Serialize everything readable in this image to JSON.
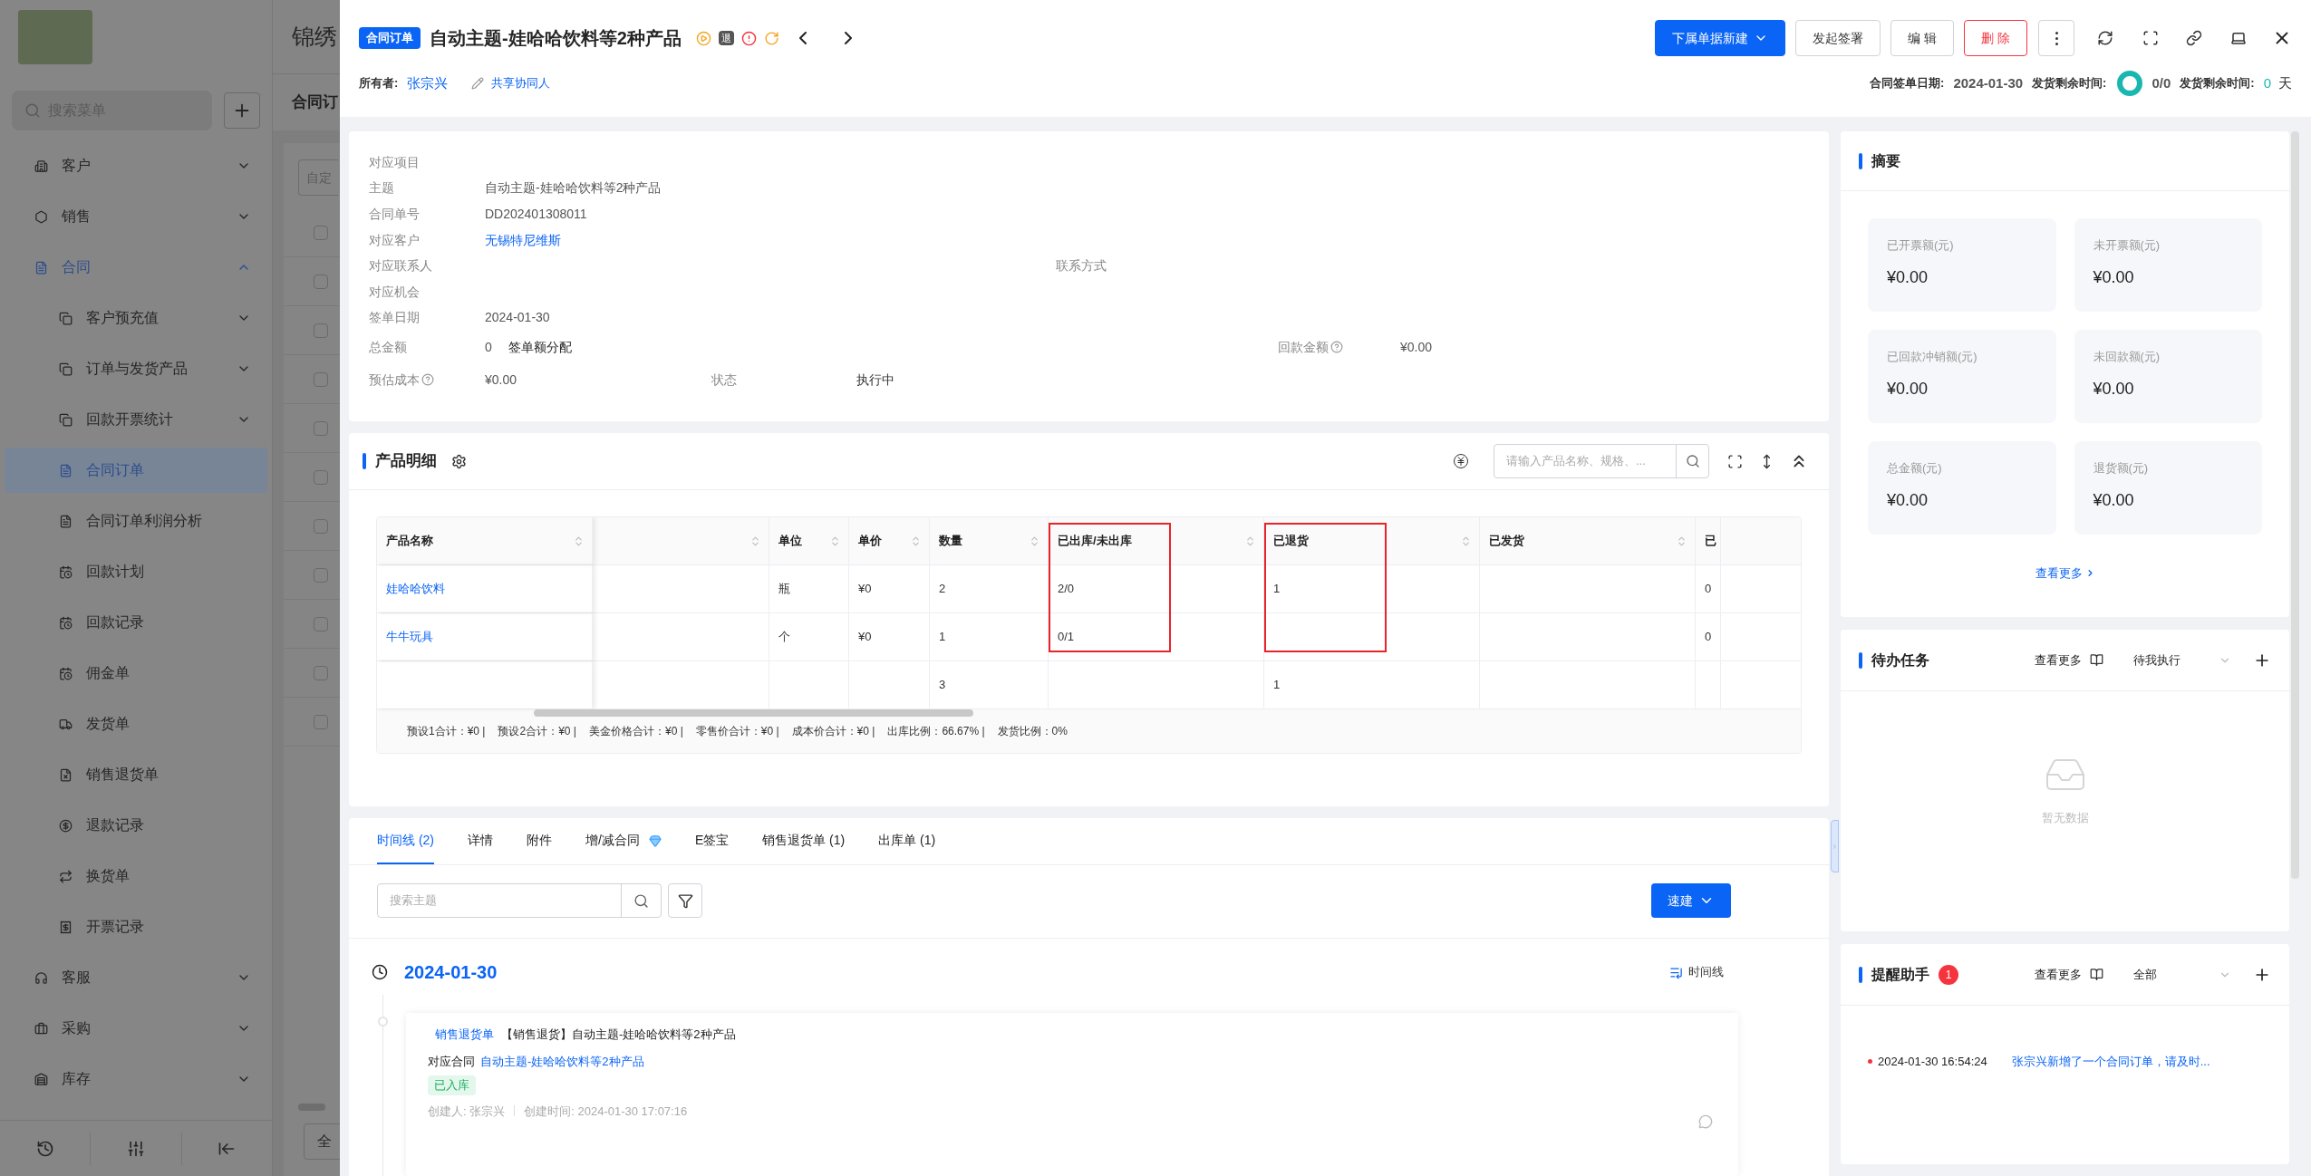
{
  "background_app": {
    "brand": "锦绣",
    "search_placeholder": "搜索菜单",
    "page_title": "合同订",
    "filter_placeholder": "自定",
    "footer_button": "全",
    "menu": [
      {
        "label": "客户",
        "expanded": false,
        "selected": false
      },
      {
        "label": "销售",
        "expanded": false,
        "selected": false
      },
      {
        "label": "合同",
        "expanded": true,
        "selected": false,
        "children": [
          {
            "label": "客户预充值",
            "expanded": false,
            "selected": false
          },
          {
            "label": "订单与发货产品",
            "expanded": false,
            "selected": false
          },
          {
            "label": "回款开票统计",
            "expanded": false,
            "selected": false
          },
          {
            "label": "合同订单",
            "selected": true
          },
          {
            "label": "合同订单利润分析",
            "selected": false
          },
          {
            "label": "回款计划",
            "selected": false
          },
          {
            "label": "回款记录",
            "selected": false
          },
          {
            "label": "佣金单",
            "selected": false
          },
          {
            "label": "发货单",
            "selected": false
          },
          {
            "label": "销售退货单",
            "selected": false
          },
          {
            "label": "退款记录",
            "selected": false
          },
          {
            "label": "换货单",
            "selected": false
          },
          {
            "label": "开票记录",
            "selected": false
          }
        ]
      },
      {
        "label": "客服",
        "expanded": false,
        "selected": false
      },
      {
        "label": "采购",
        "expanded": false,
        "selected": false
      },
      {
        "label": "库存",
        "expanded": false,
        "selected": false
      }
    ],
    "list_rows": [
      {
        "checked": false
      },
      {
        "checked": false
      },
      {
        "checked": false
      },
      {
        "checked": false
      },
      {
        "checked": false
      },
      {
        "checked": false
      },
      {
        "checked": false
      },
      {
        "checked": false
      },
      {
        "checked": false
      },
      {
        "checked": false
      },
      {
        "checked": false
      }
    ]
  },
  "drawer": {
    "tag": "合同订单",
    "title": "自动主题-娃哈哈饮料等2种产品",
    "status_badge": "退",
    "buttons": [
      {
        "label": "下属单据新建",
        "kind": "primary"
      },
      {
        "label": "发起签署",
        "kind": "default"
      },
      {
        "label": "编 辑",
        "kind": "default"
      },
      {
        "label": "删 除",
        "kind": "danger"
      }
    ],
    "owner_label": "所有者:",
    "owner": "张宗兴",
    "share": "共享协同人",
    "meta": [
      {
        "label": "合同签单日期:",
        "value": "2024-01-30"
      },
      {
        "label": "发货剩余时间:",
        "value": "0/0",
        "kind": "ring"
      },
      {
        "label": "发货剩余时间:",
        "value": "0",
        "unit": "天",
        "kind": "days"
      }
    ]
  },
  "details": {
    "rows": [
      [
        {
          "label": "对应项目"
        }
      ],
      [
        {
          "label": "主题",
          "value": "自动主题-娃哈哈饮料等2种产品",
          "kind": "text"
        }
      ],
      [
        {
          "label": "合同单号",
          "value": "DD202401308011",
          "kind": "text"
        }
      ],
      [
        {
          "label": "对应客户",
          "value": "无锡特尼维斯",
          "kind": "link"
        }
      ],
      [
        {
          "label": "对应联系人"
        },
        {
          "label": "联系方式"
        }
      ],
      [
        {
          "label": "对应机会"
        }
      ],
      [
        {
          "label": "签单日期",
          "value": "2024-01-30",
          "kind": "text"
        }
      ],
      [
        {
          "label": "总金额",
          "value": "0",
          "kind": "text",
          "action": "签单额分配"
        },
        {
          "label": "回款金额",
          "value": "¥0.00",
          "kind": "text",
          "help": true
        }
      ],
      [
        {
          "label": "预估成本",
          "value": "¥0.00",
          "kind": "text",
          "help": true
        },
        {
          "label": "状态",
          "value": "执行中",
          "kind": "strong"
        }
      ]
    ]
  },
  "products": {
    "title": "产品明细",
    "search_placeholder": "请输入产品名称、规格、...",
    "columns": [
      {
        "label": "产品名称",
        "highlighted": false
      },
      {
        "highlighted": false
      },
      {
        "label": "单位",
        "highlighted": false
      },
      {
        "label": "单价",
        "highlighted": false
      },
      {
        "label": "数量",
        "highlighted": false
      },
      {
        "label": "已出库/未出库",
        "highlighted": true
      },
      {
        "label": "已退货",
        "highlighted": true
      },
      {
        "label": "已发货",
        "highlighted": false
      },
      {
        "label": "已",
        "highlighted": false
      }
    ],
    "rows": [
      [
        "娃哈哈饮料",
        "",
        "瓶",
        "¥0",
        "2",
        "2/0",
        "1",
        "",
        "0"
      ],
      [
        "牛牛玩具",
        "",
        "个",
        "¥0",
        "1",
        "0/1",
        "",
        "",
        "0"
      ],
      [
        "",
        "",
        "",
        "",
        "3",
        "",
        "1",
        "",
        ""
      ]
    ],
    "totals": [
      "预设1合计：¥0 |",
      "预设2合计：¥0 |",
      "美金价格合计：¥0 |",
      "零售价合计：¥0 |",
      "成本价合计：¥0 |",
      "出库比例：66.67% |",
      "发货比例：0%"
    ]
  },
  "activity": {
    "tabs": [
      {
        "label": "时间线 (2)",
        "selected": true
      },
      {
        "label": "详情",
        "selected": false
      },
      {
        "label": "附件",
        "selected": false
      },
      {
        "label": "增/减合同",
        "selected": false,
        "premium": true
      },
      {
        "label": "E签宝",
        "selected": false
      },
      {
        "label": "销售退货单 (1)",
        "selected": false
      },
      {
        "label": "出库单 (1)",
        "selected": false
      }
    ],
    "search_placeholder": "搜索主题",
    "quick_create": "速建",
    "date": "2024-01-30",
    "view_toggle": "时间线",
    "entries": [
      {
        "type": "销售退货单",
        "title": "【销售退货】自动主题-娃哈哈饮料等2种产品",
        "contract_label": "对应合同",
        "contract": "自动主题-娃哈哈饮料等2种产品",
        "status": "已入库",
        "creator": "创建人: 张宗兴",
        "created": "创建时间: 2024-01-30 17:07:16"
      }
    ]
  },
  "summary": {
    "title": "摘要",
    "stats": [
      {
        "label": "已开票额(元)",
        "value": "¥0.00"
      },
      {
        "label": "未开票额(元)",
        "value": "¥0.00"
      },
      {
        "label": "已回款冲销额(元)",
        "value": "¥0.00"
      },
      {
        "label": "未回款额(元)",
        "value": "¥0.00"
      },
      {
        "label": "总金额(元)",
        "value": "¥0.00"
      },
      {
        "label": "退货额(元)",
        "value": "¥0.00"
      }
    ],
    "more": "查看更多"
  },
  "todo": {
    "title": "待办任务",
    "more": "查看更多",
    "filter": "待我执行",
    "empty": "暂无数据"
  },
  "reminders": {
    "title": "提醒助手",
    "badge": "1",
    "more": "查看更多",
    "filter": "全部",
    "items": [
      {
        "time": "2024-01-30 16:54:24",
        "text": "张宗兴新增了一个合同订单，请及时..."
      }
    ]
  }
}
